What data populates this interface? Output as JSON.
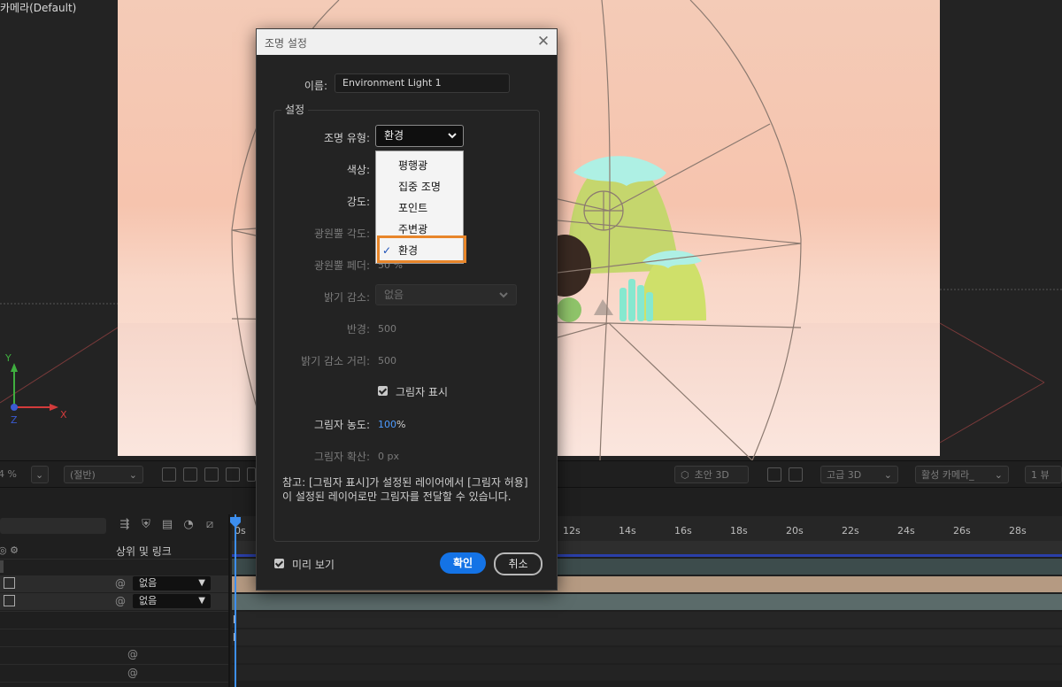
{
  "viewer": {
    "comp_label": "카메라(Default)",
    "axis": {
      "y": "Y",
      "x": "X",
      "z": "Z"
    }
  },
  "viewer_toolbar": {
    "zoom": "4 %",
    "resolution": "(절반)",
    "draft3d": "초안 3D",
    "renderer": "고급 3D",
    "camera": "활성 카메라_",
    "view": "1 뷰"
  },
  "timeline": {
    "parent_link_header": "상위 및 링크",
    "layers": [
      {
        "parent_value": "없음"
      },
      {
        "parent_value": "없음"
      }
    ],
    "ruler_start": "0s",
    "ruler_ticks": [
      "12s",
      "14s",
      "16s",
      "18s",
      "20s",
      "22s",
      "24s",
      "26s",
      "28s"
    ]
  },
  "dialog": {
    "title": "조명 설정",
    "name_label": "이름:",
    "name_value": "Environment Light 1",
    "group_label": "설정",
    "type_label": "조명 유형:",
    "type_value": "환경",
    "color_label": "색상:",
    "intensity_label": "강도:",
    "cone_angle_label": "광원뿔 각도:",
    "cone_feather_label": "광원뿔 페더:",
    "cone_feather_value": "50 %",
    "falloff_label": "밝기 감소:",
    "falloff_value": "없음",
    "radius_label": "반경:",
    "radius_value": "500",
    "falloff_distance_label": "밝기 감소 거리:",
    "falloff_distance_value": "500",
    "casts_shadows_label": "그림자 표시",
    "shadow_darkness_label": "그림자 농도:",
    "shadow_darkness_value": "100",
    "shadow_darkness_unit": "%",
    "shadow_diffusion_label": "그림자 확산:",
    "shadow_diffusion_value": "0 px",
    "note": "참고: [그림자 표시]가 설정된 레이어에서 [그림자 허용]이 설정된 레이어로만 그림자를 전달할 수 있습니다.",
    "preview_label": "미리 보기",
    "ok_label": "확인",
    "cancel_label": "취소"
  },
  "type_menu": {
    "items": [
      "평행광",
      "집중 조명",
      "포인트",
      "주변광",
      "환경"
    ],
    "selected": "환경"
  },
  "colors": {
    "accent_blue": "#1473e6",
    "highlight_orange": "#e8862a",
    "playhead": "#3d8ff0"
  }
}
